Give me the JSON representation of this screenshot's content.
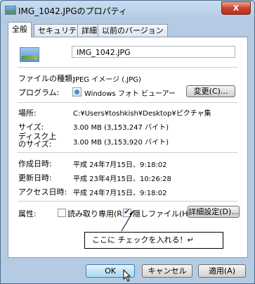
{
  "window": {
    "title": "IMG_1042.JPGのプロパティ",
    "close_label": "X"
  },
  "tabs": [
    {
      "label": "全般",
      "active": true
    },
    {
      "label": "セキュリティ",
      "active": false
    },
    {
      "label": "詳細",
      "active": false
    },
    {
      "label": "以前のバージョン",
      "active": false
    }
  ],
  "file": {
    "name": "IMG_1042.JPG",
    "icon": "jpeg-image-icon"
  },
  "properties": {
    "type_label": "ファイルの種類:",
    "type_value": "JPEG イメージ (.JPG)",
    "program_label": "プログラム:",
    "program_value": "Windows フォト ビューアー",
    "program_icon": "photo-viewer-icon",
    "change_button": "変更(C)...",
    "location_label": "場所:",
    "location_value": "C:¥Users¥toshkish¥Desktop¥ピクチャ集",
    "size_label": "サイズ:",
    "size_value": "3.00 MB (3,153,247 バイト)",
    "disk_size_label_1": "ディスク上",
    "disk_size_label_2": "のサイズ:",
    "disk_size_value": "3.00 MB (3,153,920 バイト)",
    "created_label": "作成日時:",
    "created_value": "平成 24年7月15日、9:18:02",
    "modified_label": "更新日時:",
    "modified_value": "平成 23年4月15日、10:26:28",
    "accessed_label": "アクセス日時:",
    "accessed_value": "平成 24年7月15日、9:18:02"
  },
  "attributes": {
    "label": "属性:",
    "readonly_label": "読み取り専用(R)",
    "readonly_checked": false,
    "hidden_label": "隠しファイル(H)",
    "hidden_checked": true,
    "advanced_button": "詳細設定(D)..."
  },
  "annotation": {
    "text": "ここに チェックを入れる！↵"
  },
  "footer": {
    "ok": "OK",
    "cancel": "キャンセル",
    "apply": "適用(A)"
  }
}
